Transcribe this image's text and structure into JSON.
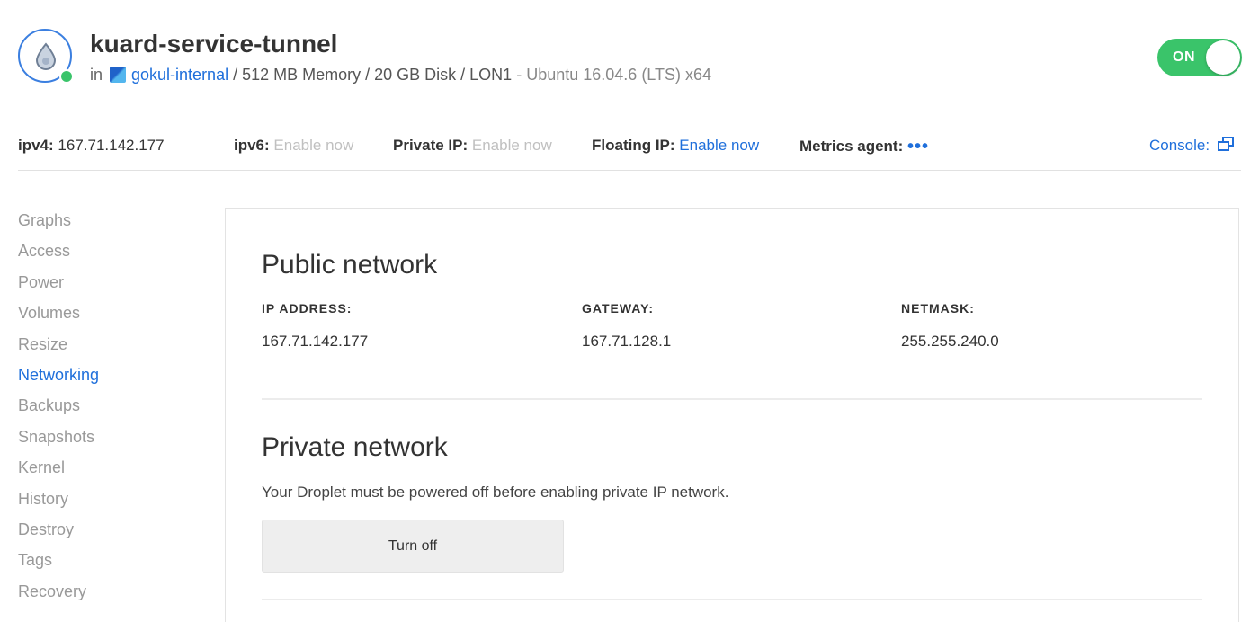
{
  "header": {
    "title": "kuard-service-tunnel",
    "in_label": "in",
    "project": "gokul-internal",
    "specs": "/ 512 MB Memory / 20 GB Disk / LON1",
    "os": "- Ubuntu 16.04.6 (LTS) x64",
    "power_state": "ON"
  },
  "infobar": {
    "ipv4_label": "ipv4:",
    "ipv4_value": "167.71.142.177",
    "ipv6_label": "ipv6:",
    "ipv6_action": "Enable now",
    "private_ip_label": "Private IP:",
    "private_ip_action": "Enable now",
    "floating_ip_label": "Floating IP:",
    "floating_ip_action": "Enable now",
    "metrics_label": "Metrics agent:",
    "metrics_value": "•••",
    "console_label": "Console:"
  },
  "sidebar": {
    "items": [
      {
        "label": "Graphs"
      },
      {
        "label": "Access"
      },
      {
        "label": "Power"
      },
      {
        "label": "Volumes"
      },
      {
        "label": "Resize"
      },
      {
        "label": "Networking"
      },
      {
        "label": "Backups"
      },
      {
        "label": "Snapshots"
      },
      {
        "label": "Kernel"
      },
      {
        "label": "History"
      },
      {
        "label": "Destroy"
      },
      {
        "label": "Tags"
      },
      {
        "label": "Recovery"
      }
    ],
    "active": "Networking"
  },
  "public_network": {
    "title": "Public network",
    "columns": [
      {
        "label": "IP ADDRESS:",
        "value": "167.71.142.177"
      },
      {
        "label": "GATEWAY:",
        "value": "167.71.128.1"
      },
      {
        "label": "NETMASK:",
        "value": "255.255.240.0"
      }
    ]
  },
  "private_network": {
    "title": "Private network",
    "note": "Your Droplet must be powered off before enabling private IP network.",
    "button_label": "Turn off"
  },
  "colors": {
    "accent": "#1f6fdb",
    "status_green": "#3ac46a",
    "muted_text": "#999999"
  },
  "icons": {
    "logo": "droplet-icon",
    "project": "project-icon",
    "console": "external-window-icon"
  }
}
